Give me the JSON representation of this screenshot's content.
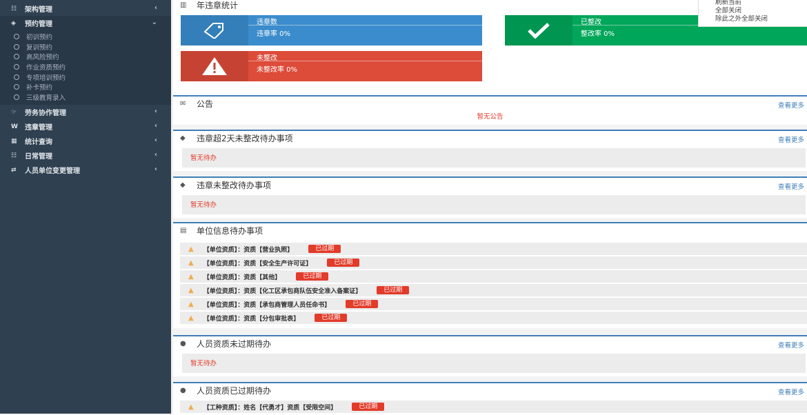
{
  "sidebar": {
    "items": [
      {
        "label": "架构管理",
        "icon": "sitemap-icon",
        "glyph": "☷"
      },
      {
        "label": "预约管理",
        "icon": "cube-icon",
        "glyph": "◈"
      },
      {
        "label": "劳务协作管理",
        "icon": "handshake-icon",
        "glyph": "☞"
      },
      {
        "label": "违章管理",
        "icon": "weibo-icon",
        "glyph": "W"
      },
      {
        "label": "统计查询",
        "icon": "table-icon",
        "glyph": "▦"
      },
      {
        "label": "日常管理",
        "icon": "sitemap-icon",
        "glyph": "☷"
      },
      {
        "label": "人员单位变更管理",
        "icon": "exchange-icon",
        "glyph": "⇄"
      }
    ],
    "submenu": [
      "初训预约",
      "复训预约",
      "高风险预约",
      "作业资质预约",
      "专项培训预约",
      "补卡预约",
      "三级教育录入"
    ]
  },
  "context_menu": [
    "刷新当前",
    "全部关闭",
    "除此之外全部关闭"
  ],
  "stats": {
    "title": "年违章统计",
    "cards": [
      {
        "label": "违章数",
        "rate": "违章率 0%",
        "color": "#3b8ccc"
      },
      {
        "label": "已整改",
        "rate": "整改率 0%",
        "color": "#00a65a"
      },
      {
        "label": "未整改",
        "rate": "未整改率 0%",
        "color": "#dd4b39"
      }
    ]
  },
  "notice": {
    "title": "公告",
    "more": "查看更多",
    "empty": "暂无公告"
  },
  "overdue": {
    "title": "违章超2天未整改待办事项",
    "more": "查看更多",
    "empty": "暂无待办"
  },
  "unrectified": {
    "title": "违章未整改待办事项",
    "more": "查看更多",
    "empty": "暂无待办"
  },
  "unit_todo": {
    "title": "单位信息待办事项",
    "rows": [
      {
        "text": "【单位资质】：资质【营业执照】",
        "badge": "已过期"
      },
      {
        "text": "【单位资质】：资质【安全生产许可证】",
        "badge": "已过期"
      },
      {
        "text": "【单位资质】：资质【其他】",
        "badge": "已过期"
      },
      {
        "text": "【单位资质】：资质【化工区承包商队伍安全准入备案证】",
        "badge": "已过期"
      },
      {
        "text": "【单位资质】：资质【承包商管理人员任命书】",
        "badge": "已过期"
      },
      {
        "text": "【单位资质】：资质【分包审批表】",
        "badge": "已过期"
      }
    ]
  },
  "person_valid": {
    "title": "人员资质未过期待办",
    "more": "查看更多",
    "empty": "暂无待办"
  },
  "person_expired": {
    "title": "人员资质已过期待办",
    "more": "查看更多",
    "rows": [
      {
        "text": "【工种资质】：姓名【代勇才】资质【受限空间】",
        "badge": "已过期"
      }
    ]
  }
}
